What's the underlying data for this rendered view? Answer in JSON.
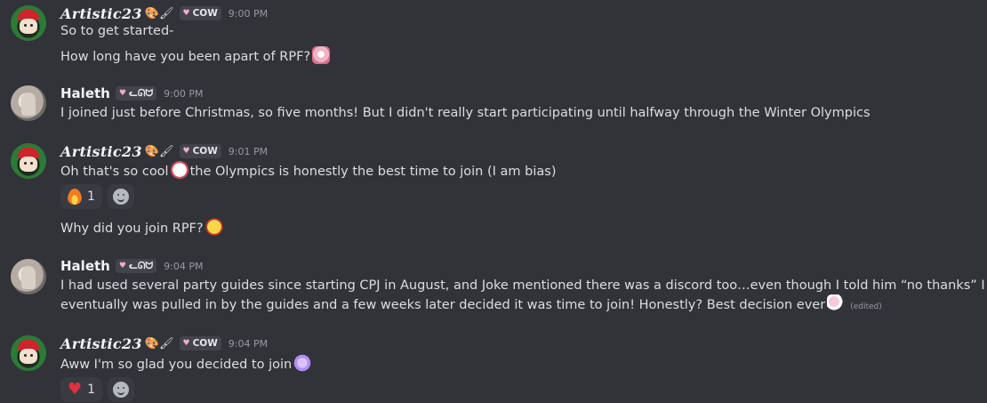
{
  "messages": [
    {
      "author": "Artistic23",
      "decorations": "🎨🖌",
      "tag": "COW",
      "time": "9:00 PM",
      "lines": [
        "So to get started-",
        "How long have you been apart of RPF?"
      ]
    },
    {
      "author": "Haleth",
      "tag": "ᓚᘏᗢ",
      "time": "9:00 PM",
      "lines": [
        "I joined just before Christmas, so five months! But I didn't really start participating until halfway through the Winter Olympics"
      ]
    },
    {
      "author": "Artistic23",
      "decorations": "🎨🖌",
      "tag": "COW",
      "time": "9:01 PM",
      "lines": [
        "Oh that's so cool",
        "the Olympics is honestly the best time to join (I am bias)",
        "Why did you join RPF?"
      ],
      "reaction": {
        "emoji": "fire-icon",
        "count": "1"
      }
    },
    {
      "author": "Haleth",
      "tag": "ᓚᘏᗢ",
      "time": "9:04 PM",
      "lines": [
        "I had used several party guides since starting CPJ in August, and Joke mentioned there was a discord too…even though I told him “no thanks” I eventually was pulled in by the guides and a few weeks later decided it was time to join! Honestly? Best decision ever"
      ],
      "edited": "(edited)"
    },
    {
      "author": "Artistic23",
      "decorations": "🎨🖌",
      "tag": "COW",
      "time": "9:04 PM",
      "lines": [
        "Aww I'm so glad you decided to join"
      ],
      "reaction": {
        "emoji": "red-heart-icon",
        "count": "1"
      }
    }
  ]
}
